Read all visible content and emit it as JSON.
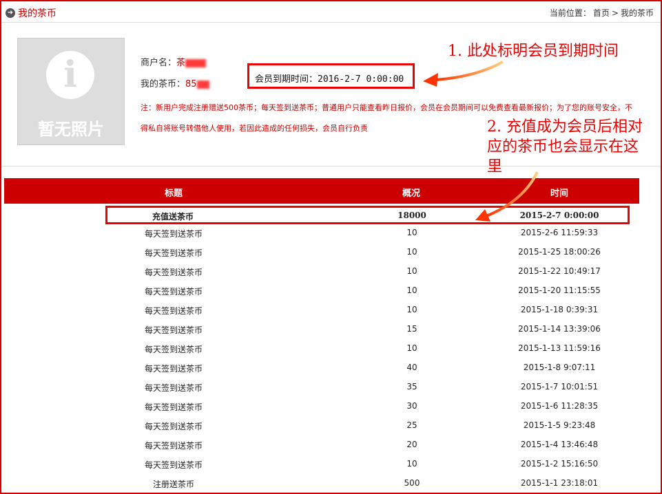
{
  "header": {
    "title": "我的茶币",
    "breadcrumb_prefix": "当前位置：",
    "breadcrumb_home": "首页",
    "breadcrumb_sep": ">",
    "breadcrumb_current": "我的茶币"
  },
  "profile": {
    "photo_text": "暂无照片",
    "merchant_label": "商户名：",
    "merchant_value": "茶",
    "coins_label": "我的茶币：",
    "coins_value": "85",
    "expiry_text": "会员到期时间：2016-2-7 0:00:00",
    "notice": "注：新用户完成注册赠送500茶币；每天签到送茶币；普通用户只能查看昨日报价，会员在会员期间可以免费查看最新报价；为了您的账号安全，不得私自将账号转借他人使用，若因此造成的任何损失，会员自行负责"
  },
  "annotations": {
    "note1": "1. 此处标明会员到期时间",
    "note2": "2. 充值成为会员后相对应的茶币也会显示在这里",
    "color": "#ee0000"
  },
  "table": {
    "headers": [
      "标题",
      "概况",
      "时间"
    ],
    "rows": [
      {
        "title": "充值送茶币",
        "amount": "18000",
        "time": "2015-2-7 0:00:00"
      },
      {
        "title": "每天签到送茶币",
        "amount": "10",
        "time": "2015-2-6 11:59:33"
      },
      {
        "title": "每天签到送茶币",
        "amount": "10",
        "time": "2015-1-25 18:00:26"
      },
      {
        "title": "每天签到送茶币",
        "amount": "10",
        "time": "2015-1-22 10:49:17"
      },
      {
        "title": "每天签到送茶币",
        "amount": "10",
        "time": "2015-1-20 11:15:55"
      },
      {
        "title": "每天签到送茶币",
        "amount": "10",
        "time": "2015-1-18 0:39:31"
      },
      {
        "title": "每天签到送茶币",
        "amount": "15",
        "time": "2015-1-14 13:39:06"
      },
      {
        "title": "每天签到送茶币",
        "amount": "10",
        "time": "2015-1-13 11:59:16"
      },
      {
        "title": "每天签到送茶币",
        "amount": "40",
        "time": "2015-1-8 9:07:11"
      },
      {
        "title": "每天签到送茶币",
        "amount": "35",
        "time": "2015-1-7 10:01:51"
      },
      {
        "title": "每天签到送茶币",
        "amount": "30",
        "time": "2015-1-6 11:28:35"
      },
      {
        "title": "每天签到送茶币",
        "amount": "25",
        "time": "2015-1-5 9:23:48"
      },
      {
        "title": "每天签到送茶币",
        "amount": "20",
        "time": "2015-1-4 13:46:48"
      },
      {
        "title": "每天签到送茶币",
        "amount": "10",
        "time": "2015-1-2 15:16:50"
      },
      {
        "title": "注册送茶币",
        "amount": "500",
        "time": "2015-1-1 23:18:01"
      }
    ]
  },
  "colors": {
    "brand": "#cc0000",
    "annotation": "#ee0000"
  }
}
